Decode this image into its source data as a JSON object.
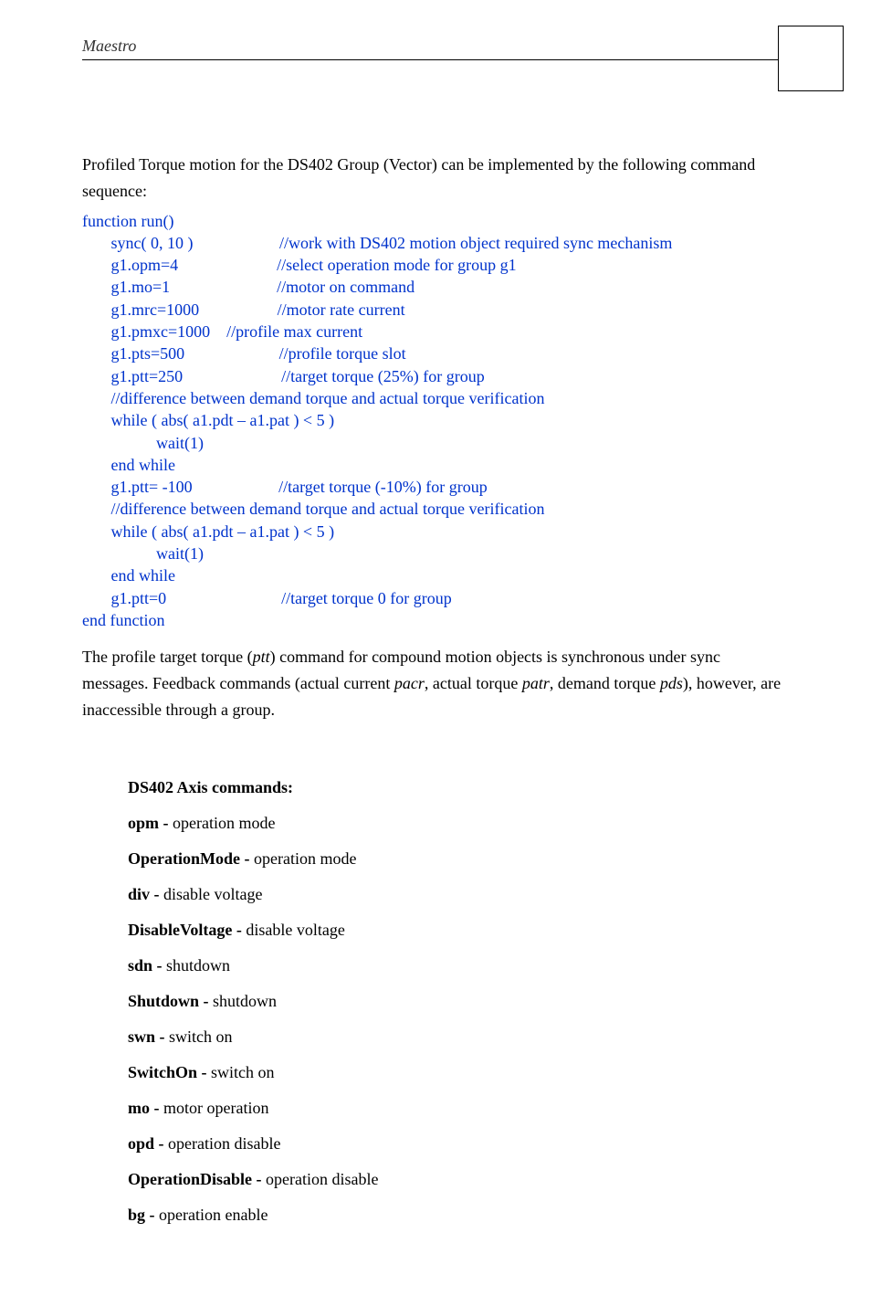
{
  "header": {
    "title": "Maestro"
  },
  "intro": "Profiled Torque motion for the DS402 Group (Vector) can be implemented by the following command sequence:",
  "code": "function run()\n       sync( 0, 10 )                     //work with DS402 motion object required sync mechanism\n       g1.opm=4                        //select operation mode for group g1\n       g1.mo=1                          //motor on command\n       g1.mrc=1000                   //motor rate current\n       g1.pmxc=1000    //profile max current\n       g1.pts=500                       //profile torque slot\n       g1.ptt=250                        //target torque (25%) for group\n       //difference between demand torque and actual torque verification\n       while ( abs( a1.pdt – a1.pat ) < 5 )\n                  wait(1)\n       end while\n       g1.ptt= -100                     //target torque (-10%) for group\n       //difference between demand torque and actual torque verification\n       while ( abs( a1.pdt – a1.pat ) < 5 )\n                  wait(1)\n       end while\n       g1.ptt=0                            //target torque 0 for group\nend function",
  "para": {
    "t1": "The profile target torque (",
    "i1": "ptt",
    "t2": ") command for compound motion objects is synchronous under sync messages. Feedback commands (actual current ",
    "i2": "pacr",
    "t3": ", actual torque ",
    "i3": "patr",
    "t4": ", demand torque ",
    "i4": "pds",
    "t5": "), however, are inaccessible through a group."
  },
  "sectionTitle": "DS402 Axis commands:",
  "commands": [
    {
      "name": "opm",
      "desc": "operation mode"
    },
    {
      "name": "OperationMode",
      "desc": "operation mode"
    },
    {
      "name": "div",
      "desc": "disable voltage"
    },
    {
      "name": "DisableVoltage",
      "desc": "disable voltage"
    },
    {
      "name": "sdn",
      "desc": "shutdown"
    },
    {
      "name": "Shutdown",
      "desc": "shutdown"
    },
    {
      "name": "swn",
      "desc": "switch on"
    },
    {
      "name": "SwitchOn",
      "desc": "switch on"
    },
    {
      "name": "mo",
      "desc": "motor operation"
    },
    {
      "name": "opd",
      "desc": "operation disable"
    },
    {
      "name": "OperationDisable",
      "desc": "operation disable"
    },
    {
      "name": "bg",
      "desc": "operation enable"
    }
  ]
}
